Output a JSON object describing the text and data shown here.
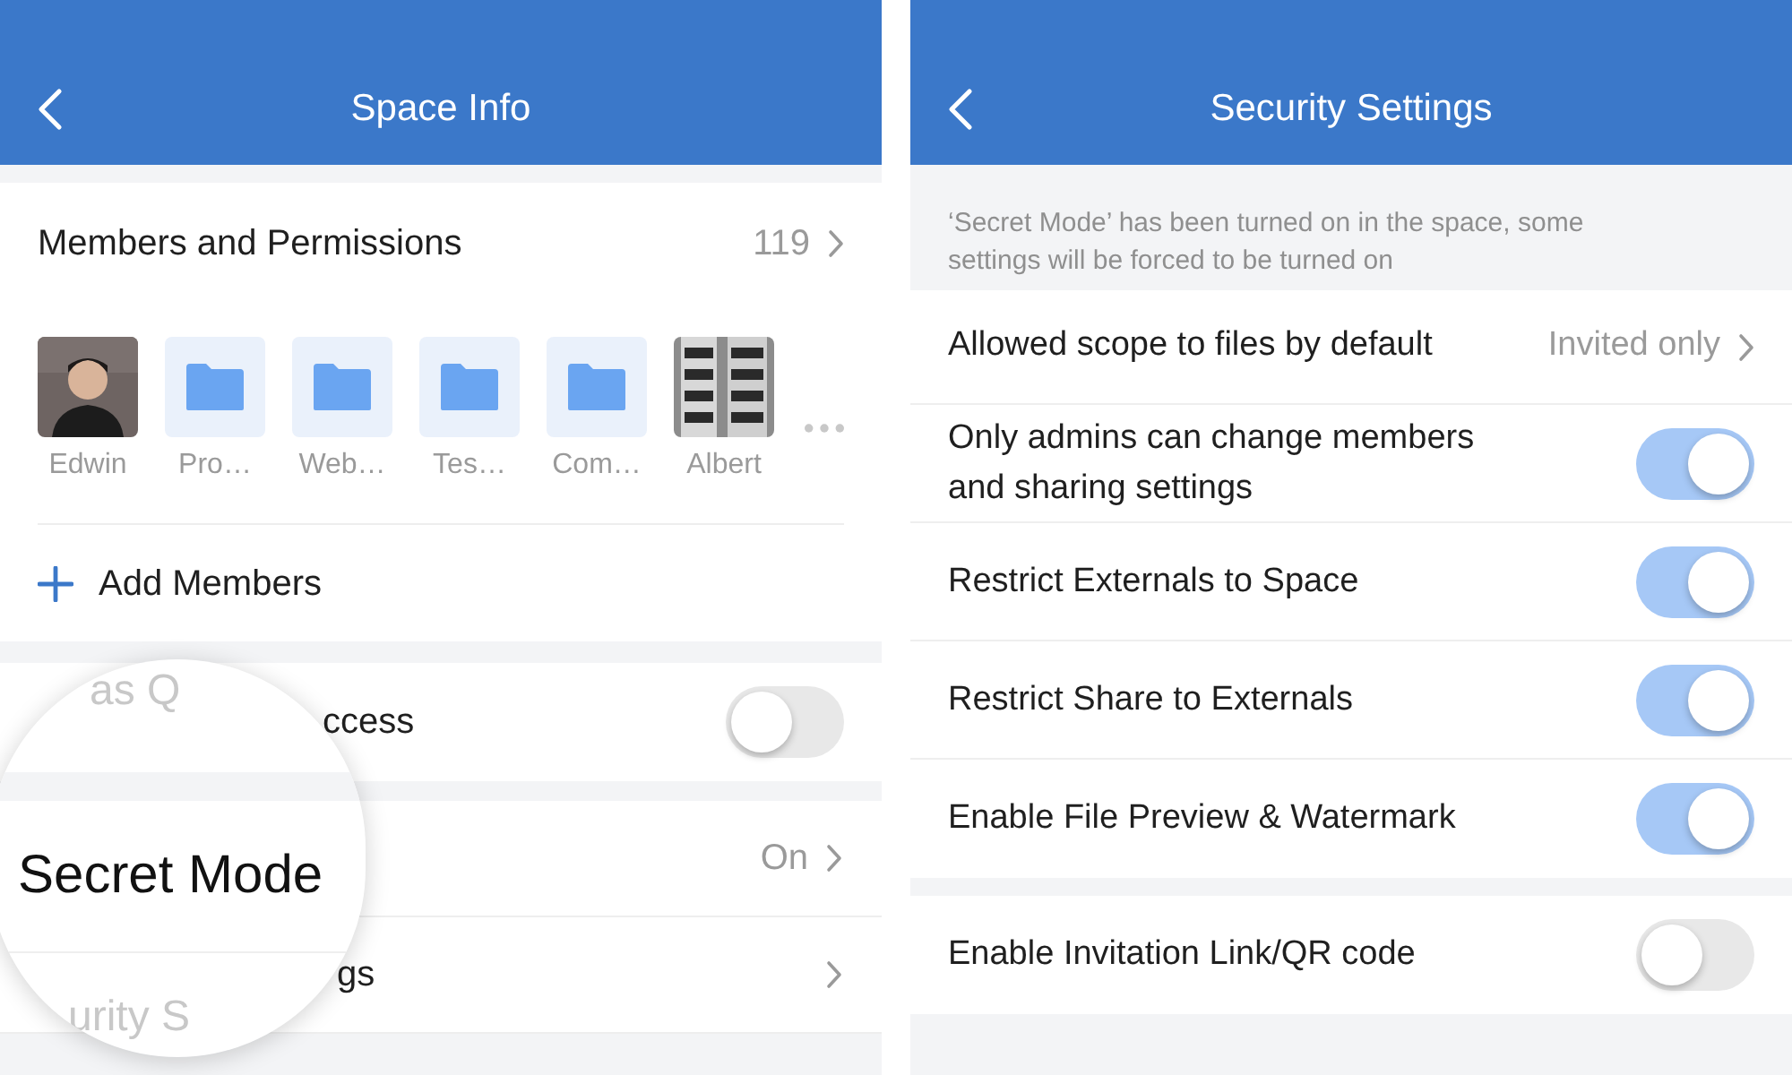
{
  "left": {
    "header": {
      "title": "Space Info"
    },
    "members": {
      "title": "Members and Permissions",
      "count": "119",
      "items": [
        {
          "kind": "avatar",
          "name": "Edwin"
        },
        {
          "kind": "folder",
          "name": "Pro…"
        },
        {
          "kind": "folder",
          "name": "Web…"
        },
        {
          "kind": "folder",
          "name": "Tes…"
        },
        {
          "kind": "folder",
          "name": "Com…"
        },
        {
          "name": "Albert"
        }
      ]
    },
    "add_members": "Add Members",
    "rows": [
      {
        "kind": "toggle",
        "label": "ccess",
        "on": false
      },
      {
        "kind": "link",
        "value": "On"
      },
      {
        "kind": "link",
        "label": "gs"
      }
    ],
    "magnifier": {
      "top_text": "as Q",
      "main_text": "Secret Mode",
      "bottom_text": "urity S"
    }
  },
  "right": {
    "header": {
      "title": "Security Settings"
    },
    "notice": "‘Secret Mode’ has been turned on in the space, some settings will be forced to be turned on",
    "groups": [
      [
        {
          "kind": "link",
          "label": "Allowed scope to files by default",
          "value": "Invited only"
        },
        {
          "kind": "toggle",
          "label": "Only admins can change members and sharing settings",
          "on": true
        },
        {
          "kind": "toggle",
          "label": "Restrict Externals to Space",
          "on": true
        },
        {
          "kind": "toggle",
          "label": "Restrict Share to Externals",
          "on": true
        },
        {
          "kind": "toggle",
          "label": "Enable File Preview & Watermark",
          "on": true
        }
      ],
      [
        {
          "kind": "toggle",
          "label": "Enable Invitation Link/QR code",
          "on": false
        }
      ]
    ]
  }
}
